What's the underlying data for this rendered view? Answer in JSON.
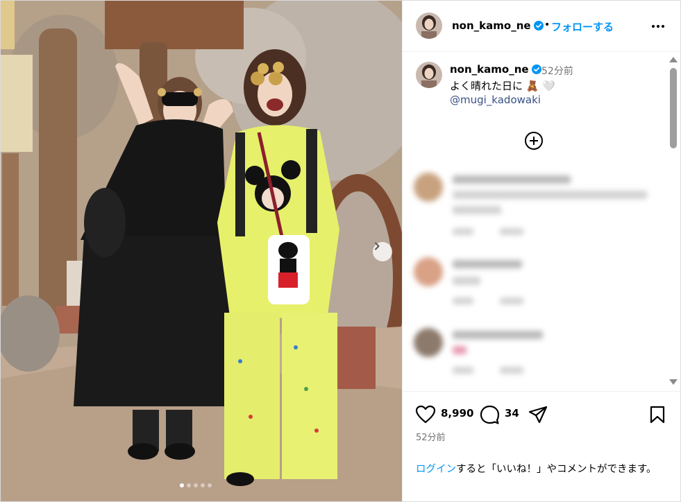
{
  "header": {
    "username": "non_kamo_ne",
    "separator": "•",
    "follow_label": "フォローする"
  },
  "caption": {
    "username": "non_kamo_ne",
    "time": "52分前",
    "text": "よく晴れた日に 🧸 🤍",
    "mention": "@mugi_kadowaki"
  },
  "post": {
    "likes": "8,990",
    "comments": "34",
    "time": "52分前"
  },
  "login_prompt": {
    "link": "ログイン",
    "text": "すると「いいね！」やコメントができます。"
  },
  "carousel": {
    "slides": 5,
    "active_index": 0
  },
  "colors": {
    "accent": "#0095f6",
    "mention": "#385185",
    "muted": "#737373",
    "verified": "#0095f6"
  },
  "icons": [
    "more-options-icon",
    "verified-badge-icon",
    "add-comment-icon",
    "heart-icon",
    "comment-icon",
    "share-icon",
    "bookmark-icon",
    "chevron-right-icon"
  ]
}
